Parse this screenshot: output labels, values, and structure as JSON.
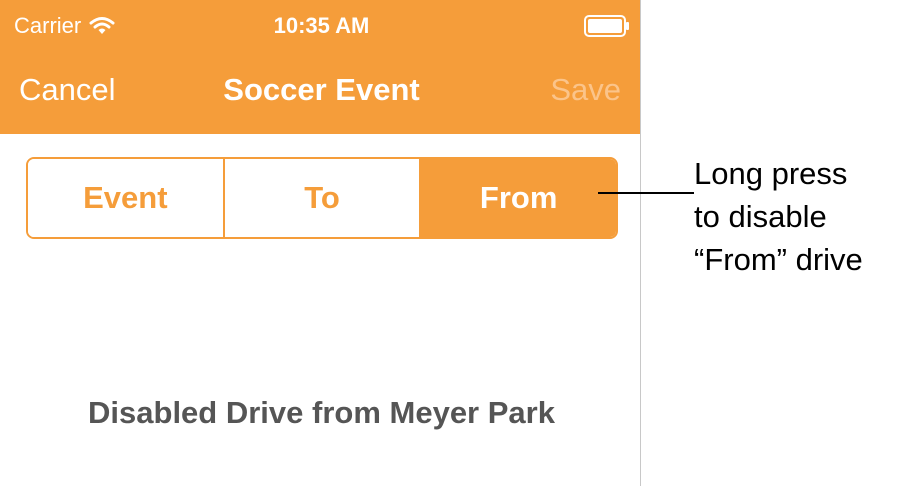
{
  "status_bar": {
    "carrier": "Carrier",
    "time": "10:35 AM",
    "wifi_icon": "wifi-icon",
    "battery_icon": "battery-icon"
  },
  "nav": {
    "cancel_label": "Cancel",
    "title": "Soccer Event",
    "save_label": "Save"
  },
  "segments": [
    {
      "label": "Event",
      "selected": false
    },
    {
      "label": "To",
      "selected": false
    },
    {
      "label": "From",
      "selected": true
    }
  ],
  "detail": {
    "text": "Disabled Drive from Meyer Park"
  },
  "annotation": {
    "lines": [
      "Long press",
      "to disable",
      "“From” drive"
    ]
  },
  "colors": {
    "accent": "#f59d3a",
    "save_disabled": "#fbc48a",
    "detail_text": "#555555"
  }
}
